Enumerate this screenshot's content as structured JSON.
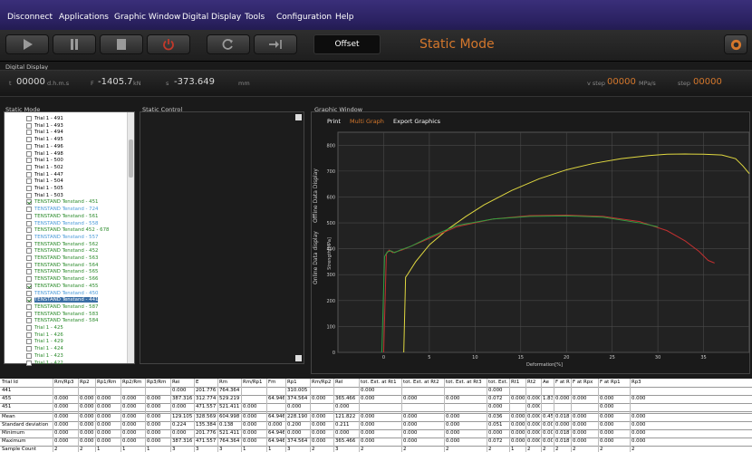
{
  "menu": [
    "Disconnect",
    "Applications",
    "Graphic Window",
    "Digital Display",
    "Tools",
    "Configuration",
    "Help"
  ],
  "toolbar": {
    "offset_label": "Offset",
    "mode_label": "Static Mode"
  },
  "panels": {
    "digital_display": "Digital Display",
    "static_mode": "Static Mode",
    "static_control": "Static Control",
    "graphic_window": "Graphic Window"
  },
  "display": {
    "t_label": "t",
    "t_value": "00000",
    "t_unit": "d.h.m.s",
    "f_label": "F",
    "f_value": "-1405.7",
    "f_unit": "kN",
    "s_label": "s",
    "s_value": "-373.649",
    "s_unit": "mm",
    "vstep_label": "v step",
    "vstep_value": "00000",
    "vstep_unit": "MPa/s",
    "step_label": "step",
    "step_value": "00000"
  },
  "trials": [
    {
      "label": "Trial 1 - 491",
      "color": "#000",
      "checked": false
    },
    {
      "label": "Trial 1 - 493",
      "color": "#000",
      "checked": false
    },
    {
      "label": "Trial 1 - 494",
      "color": "#000",
      "checked": false
    },
    {
      "label": "Trial 1 - 495",
      "color": "#000",
      "checked": false
    },
    {
      "label": "Trial 1 - 496",
      "color": "#000",
      "checked": false
    },
    {
      "label": "Trial 1 - 498",
      "color": "#000",
      "checked": false
    },
    {
      "label": "Trial 1 - 500",
      "color": "#000",
      "checked": false
    },
    {
      "label": "Trial 1 - 502",
      "color": "#000",
      "checked": false
    },
    {
      "label": "Trial 1 - 447",
      "color": "#000",
      "checked": false
    },
    {
      "label": "Trial 1 - 504",
      "color": "#000",
      "checked": false
    },
    {
      "label": "Trial 1 - 505",
      "color": "#000",
      "checked": false
    },
    {
      "label": "Trial 1 - 503",
      "color": "#000",
      "checked": false
    },
    {
      "label": "TENSTAND Tenstand - 451",
      "color": "#2a8a2a",
      "checked": true
    },
    {
      "label": "TENSTAND Tenstand - 724",
      "color": "#4a9ad8",
      "checked": false
    },
    {
      "label": "TENSTAND Tenstand - 561",
      "color": "#2a8a2a",
      "checked": false
    },
    {
      "label": "TENSTAND Tenstand - 558",
      "color": "#4a9ad8",
      "checked": false
    },
    {
      "label": "TENSTAND Tenstand 452 - 678",
      "color": "#2a8a2a",
      "checked": false
    },
    {
      "label": "TENSTAND Tenstand - 557",
      "color": "#4a9ad8",
      "checked": false
    },
    {
      "label": "TENSTAND Tenstand - 562",
      "color": "#2a8a2a",
      "checked": false
    },
    {
      "label": "TENSTAND Tenstand - 452",
      "color": "#2a8a2a",
      "checked": false
    },
    {
      "label": "TENSTAND Tenstand - 563",
      "color": "#2a8a2a",
      "checked": false
    },
    {
      "label": "TENSTAND Tenstand - 564",
      "color": "#2a8a2a",
      "checked": false
    },
    {
      "label": "TENSTAND Tenstand - 565",
      "color": "#2a8a2a",
      "checked": false
    },
    {
      "label": "TENSTAND Tenstand - 566",
      "color": "#2a8a2a",
      "checked": false
    },
    {
      "label": "TENSTAND Tenstand - 455",
      "color": "#2a8a2a",
      "checked": true
    },
    {
      "label": "TENSTAND Tenstand - 450",
      "color": "#4a9ad8",
      "checked": false
    },
    {
      "label": "TENSTAND Tenstand - 441",
      "color": "#fff",
      "checked": true,
      "selected": true
    },
    {
      "label": "TENSTAND Tenstand - 587",
      "color": "#2a8a2a",
      "checked": false
    },
    {
      "label": "TENSTAND Tenstand - 583",
      "color": "#2a8a2a",
      "checked": false
    },
    {
      "label": "TENSTAND Tenstand - 584",
      "color": "#2a8a2a",
      "checked": false
    },
    {
      "label": "Trial 1 - 425",
      "color": "#2a8a2a",
      "checked": false
    },
    {
      "label": "Trial 1 - 426",
      "color": "#2a8a2a",
      "checked": false
    },
    {
      "label": "Trial 1 - 429",
      "color": "#2a8a2a",
      "checked": false
    },
    {
      "label": "Trial 1 - 424",
      "color": "#2a8a2a",
      "checked": false
    },
    {
      "label": "Trial 1 - 423",
      "color": "#2a8a2a",
      "checked": false
    },
    {
      "label": "Trial 1 - 422",
      "color": "#2a8a2a",
      "checked": false
    }
  ],
  "graph_tabs": {
    "print": "Print",
    "multi_graph": "Multi Graph",
    "export": "Export Graphics",
    "vertical_tabs": [
      "Offline Data Display",
      "Online Data display"
    ]
  },
  "chart_data": {
    "type": "line",
    "xlabel": "Deformation[%]",
    "ylabel": "Strength[MPa]",
    "xlim": [
      -5,
      40
    ],
    "ylim": [
      0,
      850
    ],
    "x_ticks": [
      0,
      5,
      10,
      15,
      20,
      25,
      30,
      35
    ],
    "y_ticks": [
      0,
      100,
      200,
      300,
      400,
      500,
      600,
      700,
      800
    ],
    "grid": true,
    "series": [
      {
        "color": "#e0d840",
        "x": [
          2.2,
          2.4,
          2.6,
          3.5,
          5,
          7,
          9,
          11,
          14,
          17,
          20,
          23,
          26,
          29,
          31,
          33,
          35,
          37,
          38.5,
          39.3,
          40
        ],
        "y": [
          0,
          290,
          300,
          350,
          415,
          475,
          525,
          570,
          625,
          670,
          705,
          730,
          748,
          760,
          765,
          766,
          765,
          762,
          748,
          720,
          690
        ]
      },
      {
        "color": "#c03030",
        "x": [
          0,
          0.3,
          0.6,
          1,
          1.5,
          2,
          3,
          5,
          8,
          12,
          16,
          20,
          24,
          28,
          31,
          33,
          34.5,
          35.5,
          36.2
        ],
        "y": [
          0,
          380,
          395,
          385,
          390,
          395,
          410,
          440,
          485,
          515,
          528,
          530,
          525,
          505,
          470,
          430,
          390,
          355,
          345
        ]
      },
      {
        "color": "#30a040",
        "x": [
          -0.2,
          0.1,
          0.4,
          0.8,
          1.2,
          1.8,
          3,
          5,
          8,
          12,
          16,
          20,
          24,
          28,
          30
        ],
        "y": [
          0,
          370,
          388,
          392,
          385,
          395,
          410,
          445,
          490,
          515,
          525,
          527,
          522,
          500,
          485
        ]
      }
    ]
  },
  "table": {
    "headers": [
      "Trial Id",
      "Rm/Rp3",
      "Rp2",
      "Rp1/Rm",
      "Rp2/Rm",
      "Rp3/Rm",
      "Rei",
      "E",
      "Rm",
      "Rm/Rp1",
      "Fm",
      "Rp1",
      "Rm/Rp2",
      "Rel",
      "tot. Ext. at Rt1",
      "tot. Ext. at Rt2",
      "tot. Ext. at Rt3",
      "tot. Ext. at Rei",
      "Rt1",
      "Rt2",
      "Ae",
      "F at Rp2",
      "F at Rpx",
      "F at Rp1",
      "Rp3"
    ],
    "rows": [
      [
        "441",
        "",
        "",
        "",
        "",
        "",
        "0.000",
        "201.776",
        "764.364",
        "",
        "",
        "310.005",
        "",
        "",
        "0.000",
        "",
        "",
        "0.000",
        "",
        "",
        "",
        "",
        "",
        "",
        ""
      ],
      [
        "455",
        "0.000",
        "0.000",
        "0.000",
        "0.000",
        "0.000",
        "387.316",
        "312.774",
        "529.219",
        "",
        "64.946",
        "374.564",
        "0.000",
        "365.466",
        "0.000",
        "0.000",
        "0.000",
        "0.072",
        "0.000",
        "0.000",
        "1.836",
        "0.000",
        "0.000",
        "0.000",
        "0.000"
      ],
      [
        "451",
        "0.000",
        "0.000",
        "0.000",
        "0.000",
        "0.000",
        "0.000",
        "471.557",
        "521.411",
        "0.000",
        "",
        "0.000",
        "",
        "0.000",
        "",
        "",
        "",
        "0.000",
        "",
        "0.000",
        "",
        "",
        "",
        "0.000",
        ""
      ]
    ],
    "stats": [
      [
        "Mean",
        "0.000",
        "0.000",
        "0.000",
        "0.000",
        "0.000",
        "129.105",
        "328.569",
        "604.998",
        "0.000",
        "64.946",
        "228.190",
        "0.000",
        "121.822",
        "0.000",
        "0.000",
        "0.000",
        "0.036",
        "0.000",
        "0.000",
        "0.459",
        "0.018",
        "0.000",
        "0.000",
        "0.000"
      ],
      [
        "Standard deviation",
        "0.000",
        "0.000",
        "0.000",
        "0.000",
        "0.000",
        "0.224",
        "135.384",
        "0.138",
        "0.000",
        "0.000",
        "0.200",
        "0.000",
        "0.211",
        "0.000",
        "0.000",
        "0.000",
        "0.051",
        "0.000",
        "0.000",
        "0.000",
        "0.000",
        "0.000",
        "0.000",
        "0.000"
      ],
      [
        "Minimum",
        "0.000",
        "0.000",
        "0.000",
        "0.000",
        "0.000",
        "0.000",
        "201.776",
        "521.411",
        "0.000",
        "64.946",
        "0.000",
        "0.000",
        "0.000",
        "0.000",
        "0.000",
        "0.000",
        "0.000",
        "0.000",
        "0.000",
        "0.000",
        "0.018",
        "0.000",
        "0.000",
        "0.000"
      ],
      [
        "Maximum",
        "0.000",
        "0.000",
        "0.000",
        "0.000",
        "0.000",
        "387.316",
        "471.557",
        "764.364",
        "0.000",
        "64.946",
        "374.564",
        "0.000",
        "365.466",
        "0.000",
        "0.000",
        "0.000",
        "0.072",
        "0.000",
        "0.000",
        "0.000",
        "0.018",
        "0.000",
        "0.000",
        "0.000"
      ],
      [
        "Sample Count",
        "2",
        "2",
        "1",
        "1",
        "1",
        "3",
        "3",
        "3",
        "1",
        "1",
        "3",
        "2",
        "3",
        "2",
        "2",
        "2",
        "2",
        "1",
        "2",
        "2",
        "2",
        "2",
        "2",
        "2"
      ]
    ]
  }
}
